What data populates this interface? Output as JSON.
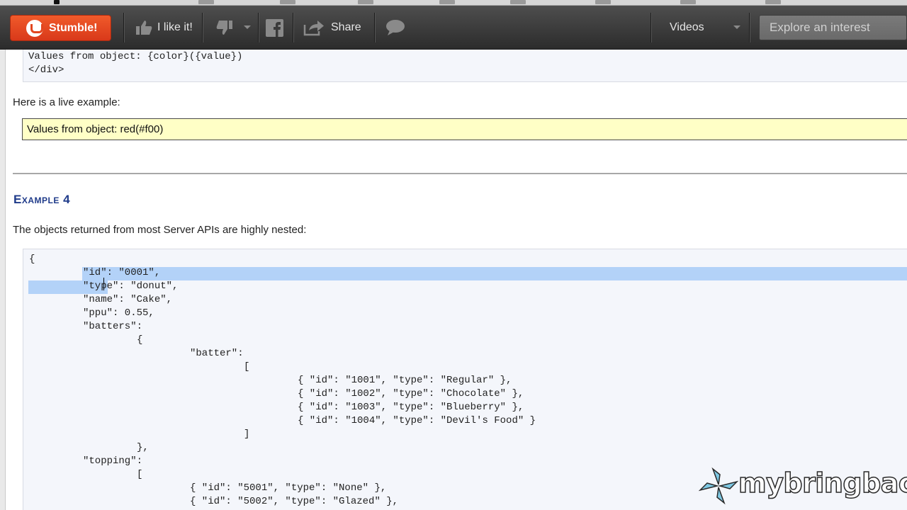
{
  "toolbar": {
    "stumble_label": "Stumble!",
    "like_label": "I like it!",
    "share_label": "Share",
    "videos_label": "Videos",
    "explore_placeholder": "Explore an interest"
  },
  "top_code": {
    "lines": [
      "Values from object: {color}({value})",
      "</div>"
    ]
  },
  "live_label": "Here is a live example:",
  "live_result": "Values from object: red(#f00)",
  "heading": "Example 4",
  "description": "The objects returned from most Server APIs are highly nested:",
  "json_code": {
    "lines": [
      "{",
      "\"id\": \"0001\",",
      "\"type\": \"donut\",",
      "\"name\": \"Cake\",",
      "\"ppu\": 0.55,",
      "\"batters\":",
      "{",
      "\"batter\":",
      "[",
      "{ \"id\": \"1001\", \"type\": \"Regular\" },",
      "{ \"id\": \"1002\", \"type\": \"Chocolate\" },",
      "{ \"id\": \"1003\", \"type\": \"Blueberry\" },",
      "{ \"id\": \"1004\", \"type\": \"Devil's Food\" }",
      "]",
      "},",
      "\"topping\":",
      "[",
      "{ \"id\": \"5001\", \"type\": \"None\" },",
      "{ \"id\": \"5002\", \"type\": \"Glazed\" },"
    ]
  },
  "watermark": "mybringback",
  "colors": {
    "stumble_orange": "#e2461f",
    "heading_blue": "#1f3b8a",
    "live_bg": "#ffffc6",
    "selection": "#b3d2f8"
  }
}
